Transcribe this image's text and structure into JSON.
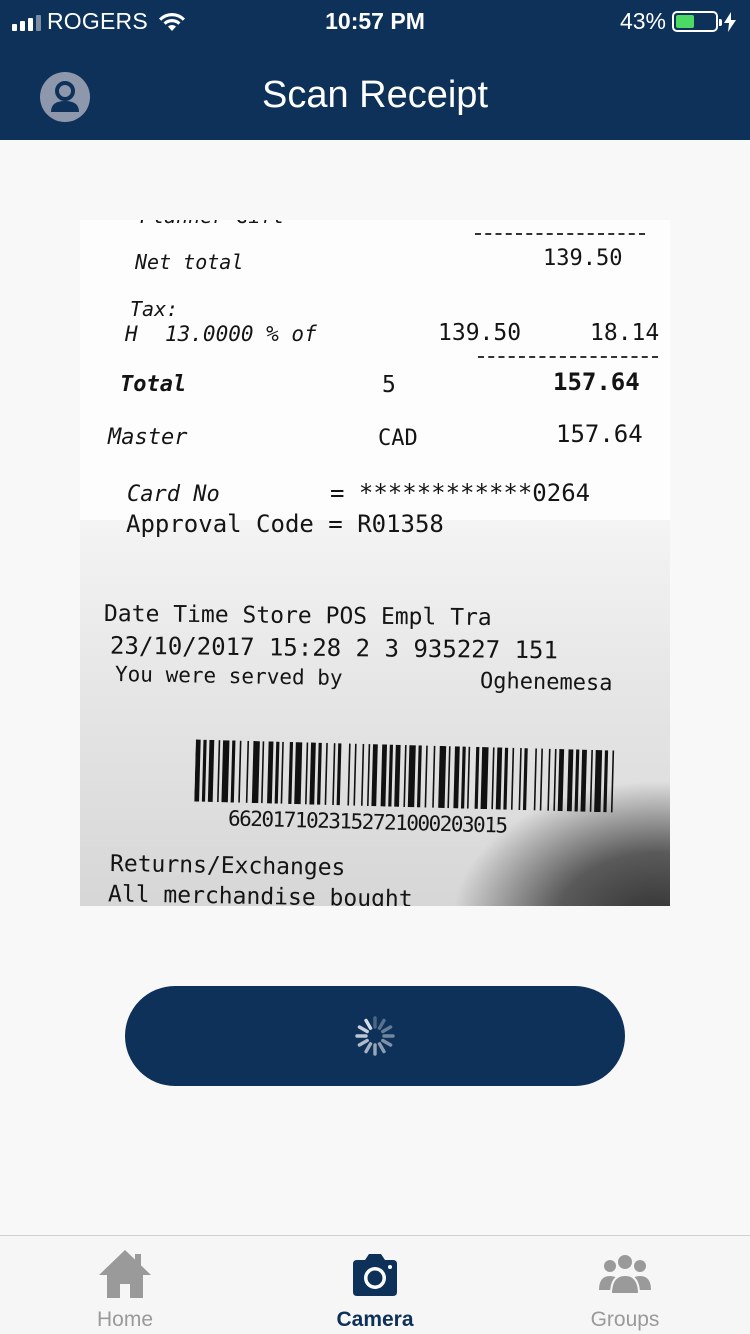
{
  "status_bar": {
    "carrier": "ROGERS",
    "time": "10:57 PM",
    "battery_percent": "43%",
    "battery_level": 0.43,
    "icons": [
      "signal-icon",
      "wifi-icon",
      "battery-icon",
      "charging-bolt-icon"
    ]
  },
  "header": {
    "title": "Scan Receipt",
    "profile_icon": "user-avatar-icon"
  },
  "receipt": {
    "top_cut": "Planner Gift",
    "net_total_label": "Net total",
    "net_total_value": "139.50",
    "tax_label": "Tax:",
    "tax_line_code": "H",
    "tax_line_rate": "13.0000 % of",
    "tax_line_base": "139.50",
    "tax_line_amount": "18.14",
    "total_label": "Total",
    "total_count": "5",
    "total_value": "157.64",
    "payment_label": "Master",
    "payment_currency": "CAD",
    "payment_value": "157.64",
    "card_no_label": "Card No",
    "card_no_value": "= ************0264",
    "approval_line": "Approval Code = R01358",
    "cols_header": "Date       Time  Store POS Empl    Tra",
    "cols_values": "23/10/2017 15:28  2       3 935227  151",
    "served_label": "You were served by",
    "served_name": "Oghenemesa",
    "barcode_number": "6620171023152721000203015",
    "returns_heading": "Returns/Exchanges",
    "returns_cut": "All merchandise bought"
  },
  "action_button": {
    "state": "loading",
    "spinner_icon": "spinner-icon"
  },
  "tab_bar": {
    "tabs": [
      {
        "label": "Home",
        "icon": "home-icon",
        "active": false
      },
      {
        "label": "Camera",
        "icon": "camera-icon",
        "active": true
      },
      {
        "label": "Groups",
        "icon": "groups-icon",
        "active": false
      }
    ]
  },
  "colors": {
    "primary": "#0d3158",
    "background": "#f8f8f9",
    "battery": "#4cd964",
    "tab_inactive": "#9a9a9a"
  }
}
